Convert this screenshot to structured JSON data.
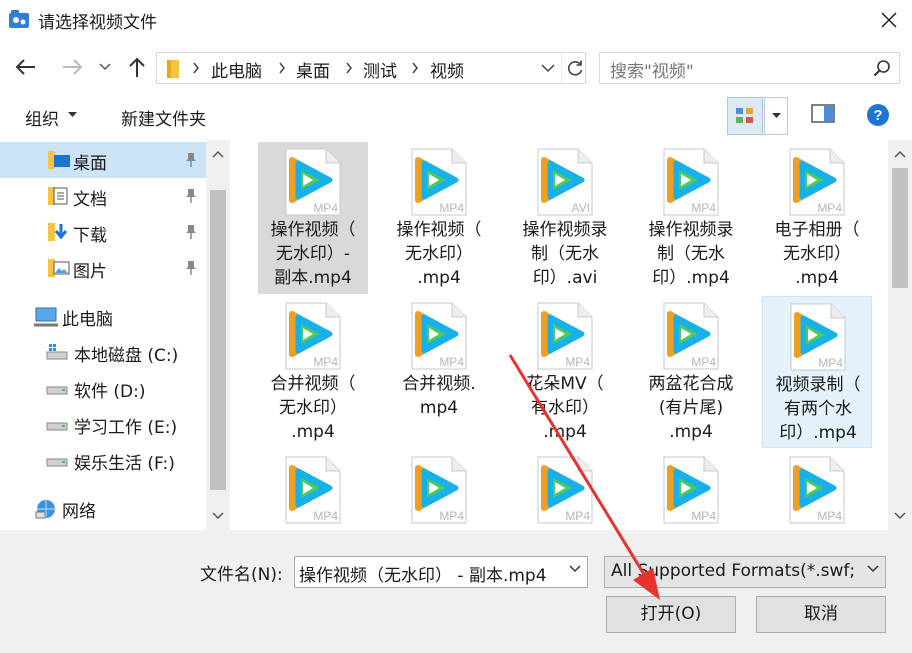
{
  "window": {
    "title": "请选择视频文件"
  },
  "address": {
    "crumbs": [
      "此电脑",
      "桌面",
      "测试",
      "视频"
    ]
  },
  "search": {
    "placeholder": "搜索\"视频\""
  },
  "toolbar": {
    "organize": "组织",
    "new_folder": "新建文件夹"
  },
  "sidebar": {
    "items": [
      {
        "label": "桌面",
        "icon": "desktop-folder-icon",
        "pinned": true,
        "selected": true
      },
      {
        "label": "文档",
        "icon": "documents-icon",
        "pinned": true
      },
      {
        "label": "下载",
        "icon": "downloads-icon",
        "pinned": true
      },
      {
        "label": "图片",
        "icon": "pictures-icon",
        "pinned": true
      },
      {
        "label": "此电脑",
        "icon": "this-pc-icon"
      },
      {
        "label": "本地磁盘 (C:)",
        "icon": "system-drive-icon"
      },
      {
        "label": "软件 (D:)",
        "icon": "drive-icon"
      },
      {
        "label": "学习工作 (E:)",
        "icon": "drive-icon"
      },
      {
        "label": "娱乐生活 (F:)",
        "icon": "drive-icon"
      },
      {
        "label": "网络",
        "icon": "network-icon"
      }
    ]
  },
  "files": [
    {
      "lines": [
        "操作视频（",
        "无水印）-",
        "副本.mp4"
      ],
      "ext": "MP4",
      "state": "selected"
    },
    {
      "lines": [
        "操作视频（",
        "无水印）",
        ".mp4"
      ],
      "ext": "MP4"
    },
    {
      "lines": [
        "操作视频录",
        "制（无水",
        "印）.avi"
      ],
      "ext": "AVI"
    },
    {
      "lines": [
        "操作视频录",
        "制（无水",
        "印）.mp4"
      ],
      "ext": "MP4"
    },
    {
      "lines": [
        "电子相册（",
        "无水印）",
        ".mp4"
      ],
      "ext": "MP4"
    },
    {
      "lines": [
        "合并视频（",
        "无水印）",
        ".mp4"
      ],
      "ext": "MP4"
    },
    {
      "lines": [
        "合并视频.",
        "mp4"
      ],
      "ext": "MP4"
    },
    {
      "lines": [
        "花朵MV（",
        "有水印）",
        ".mp4"
      ],
      "ext": "MP4"
    },
    {
      "lines": [
        "两盆花合成",
        "(有片尾)",
        ".mp4"
      ],
      "ext": "MP4"
    },
    {
      "lines": [
        "视频录制（",
        "有两个水",
        "印）.mp4"
      ],
      "ext": "MP4",
      "state": "hover"
    },
    {
      "lines": [],
      "ext": "MP4"
    },
    {
      "lines": [],
      "ext": "MP4"
    },
    {
      "lines": [],
      "ext": "MP4"
    },
    {
      "lines": [],
      "ext": "MP4"
    },
    {
      "lines": [],
      "ext": "MP4"
    }
  ],
  "bottom": {
    "filename_label": "文件名(N):",
    "filename_value": "操作视频（无水印） - 副本.mp4",
    "filter_value": "All Supported Formats(*.swf;",
    "open_label": "打开(O)",
    "cancel_label": "取消"
  },
  "colors": {
    "accent": "#0078d7",
    "selection": "#cce4f7",
    "arrow": "#e8322e"
  }
}
